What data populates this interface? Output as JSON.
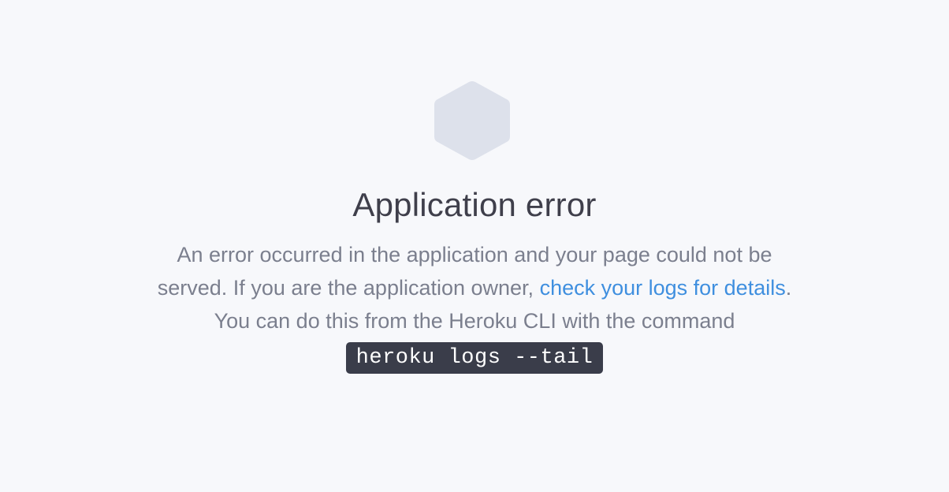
{
  "error": {
    "title": "Application error",
    "line1": "An error occurred in the application and your page could not be",
    "line2_before": "served. If you are the application owner, ",
    "line2_link": "check your logs for details",
    "line2_after": ".",
    "line3": "You can do this from the Heroku CLI with the command",
    "command": "heroku logs --tail"
  },
  "colors": {
    "background": "#f7f8fb",
    "hexagon": "#dde1eb",
    "title": "#3f3f4b",
    "text": "#7b7f8e",
    "link": "#3f8fdf",
    "code_bg": "#3a3d4a"
  },
  "icons": {
    "hero": "hexagon-icon"
  }
}
